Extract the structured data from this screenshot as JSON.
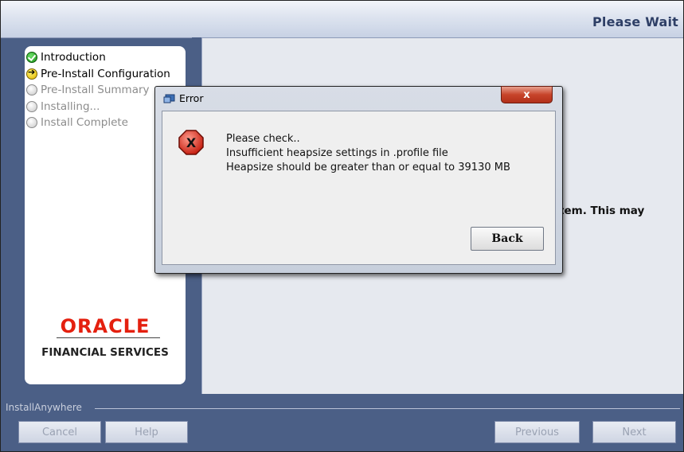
{
  "window": {
    "title": "Please Wait"
  },
  "steps": [
    {
      "label": "Introduction",
      "state": "done"
    },
    {
      "label": "Pre-Install Configuration",
      "state": "current"
    },
    {
      "label": "Pre-Install Summary",
      "state": "pending"
    },
    {
      "label": "Installing...",
      "state": "pending"
    },
    {
      "label": "Install Complete",
      "state": "pending"
    }
  ],
  "branding": {
    "oracle": "ORACLE",
    "financial_services": "FINANCIAL SERVICES",
    "brand_color": "#e4200f"
  },
  "main": {
    "partial_text": "stem.  This may"
  },
  "footer": {
    "label": "InstallAnywhere",
    "cancel": "Cancel",
    "help": "Help",
    "previous": "Previous",
    "next": "Next"
  },
  "dialog": {
    "title": "Error",
    "close_label": "x",
    "icon": "error-icon",
    "lines": [
      "Please check..",
      "Insufficient heapsize settings in .profile file",
      "Heapsize should be greater than or equal to 39130 MB"
    ],
    "back_label": "Back"
  }
}
